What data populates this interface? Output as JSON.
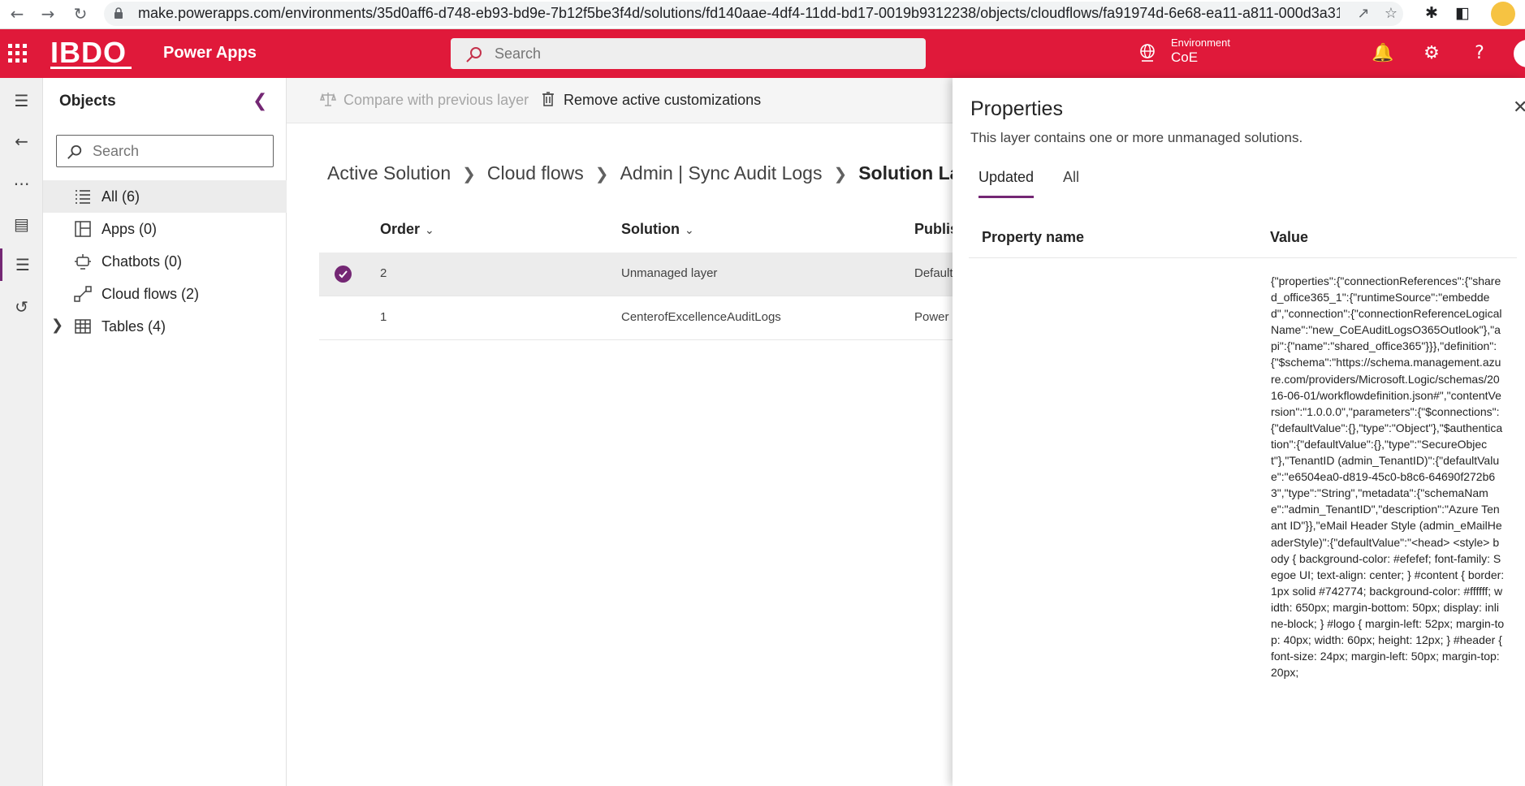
{
  "browser": {
    "url": "make.powerapps.com/environments/35d0aff6-d748-eb93-bd9e-7b12f5be3f4d/solutions/fd140aae-4df4-11dd-bd17-0019b9312238/objects/cloudflows/fa91974d-6e68-ea11-a811-000d3a31..."
  },
  "header": {
    "logo_text": "IBDO",
    "app_name": "Power Apps",
    "search_placeholder": "Search",
    "environment_label": "Environment",
    "environment_name": "CoE",
    "brand_color": "#e0193a"
  },
  "objects_panel": {
    "title": "Objects",
    "search_placeholder": "Search",
    "items": [
      {
        "label": "All (6)",
        "icon": "list-icon",
        "selected": true
      },
      {
        "label": "Apps (0)",
        "icon": "apps-icon"
      },
      {
        "label": "Chatbots (0)",
        "icon": "chatbot-icon"
      },
      {
        "label": "Cloud flows (2)",
        "icon": "flow-icon"
      },
      {
        "label": "Tables (4)",
        "icon": "table-icon",
        "expandable": true
      }
    ]
  },
  "command_bar": {
    "compare_label": "Compare with previous layer",
    "remove_label": "Remove active customizations"
  },
  "breadcrumb": [
    "Active Solution",
    "Cloud flows",
    "Admin | Sync Audit Logs",
    "Solution Layers"
  ],
  "table": {
    "columns": [
      "Order",
      "Solution",
      "Publis"
    ],
    "rows": [
      {
        "order": "2",
        "solution": "Unmanaged layer",
        "publisher": "Default",
        "selected": true
      },
      {
        "order": "1",
        "solution": "CenterofExcellenceAuditLogs",
        "publisher": "Power"
      }
    ]
  },
  "properties": {
    "title": "Properties",
    "description": "This layer contains one or more unmanaged solutions.",
    "tabs": [
      "Updated",
      "All"
    ],
    "active_tab": "Updated",
    "columns": [
      "Property name",
      "Value"
    ],
    "value": "{\"properties\":{\"connectionReferences\":{\"shared_office365_1\":{\"runtimeSource\":\"embedded\",\"connection\":{\"connectionReferenceLogicalName\":\"new_CoEAuditLogsO365Outlook\"},\"api\":{\"name\":\"shared_office365\"}}},\"definition\":{\"$schema\":\"https://schema.management.azure.com/providers/Microsoft.Logic/schemas/2016-06-01/workflowdefinition.json#\",\"contentVersion\":\"1.0.0.0\",\"parameters\":{\"$connections\":{\"defaultValue\":{},\"type\":\"Object\"},\"$authentication\":{\"defaultValue\":{},\"type\":\"SecureObject\"},\"TenantID (admin_TenantID)\":{\"defaultValue\":\"e6504ea0-d819-45c0-b8c6-64690f272b63\",\"type\":\"String\",\"metadata\":{\"schemaName\":\"admin_TenantID\",\"description\":\"Azure Tenant ID\"}},\"eMail Header Style (admin_eMailHeaderStyle)\":{\"defaultValue\":\"<head> <style> body { background-color: #efefef; font-family: Segoe UI; text-align: center; } #content { border: 1px solid #742774; background-color: #ffffff; width: 650px; margin-bottom: 50px; display: inline-block; } #logo { margin-left: 52px; margin-top: 40px; width: 60px; height: 12px; } #header { font-size: 24px; margin-left: 50px; margin-top: 20px;"
  }
}
